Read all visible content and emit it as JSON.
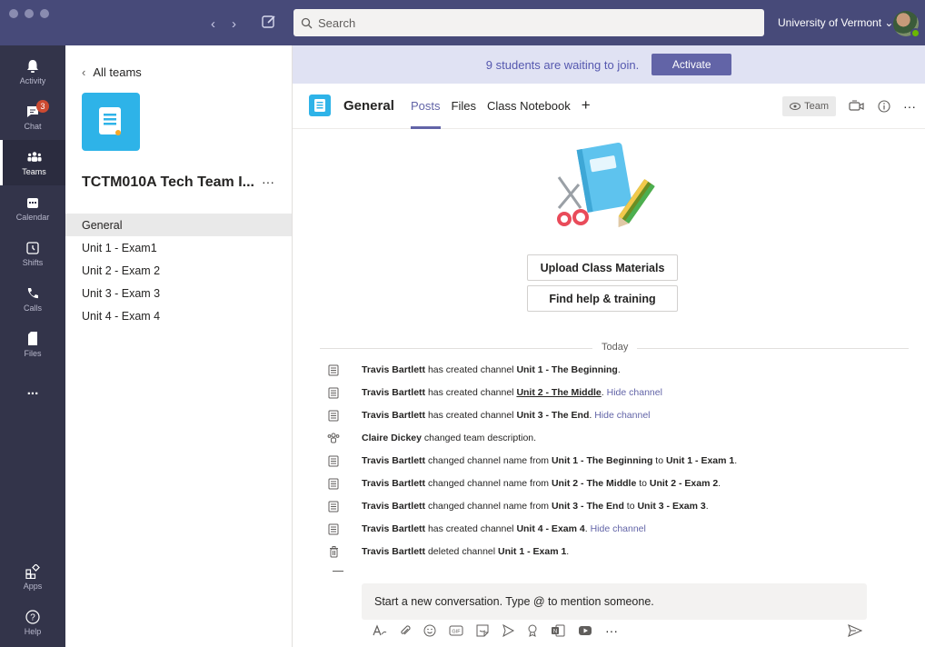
{
  "titlebar": {
    "search_placeholder": "Search",
    "org_label": "University of Vermont ⌄"
  },
  "rail": {
    "items": [
      {
        "label": "Activity"
      },
      {
        "label": "Chat",
        "badge": "3"
      },
      {
        "label": "Teams"
      },
      {
        "label": "Calendar"
      },
      {
        "label": "Shifts"
      },
      {
        "label": "Calls"
      },
      {
        "label": "Files"
      },
      {
        "label": "..."
      },
      {
        "label": "Apps"
      },
      {
        "label": "Help"
      }
    ]
  },
  "teampanel": {
    "back_label": "All teams",
    "team_name": "TCTM010A Tech Team I...",
    "more": "···",
    "channels": [
      "General",
      "Unit 1 - Exam1",
      "Unit 2 - Exam 2",
      "Unit 3 - Exam 3",
      "Unit 4 - Exam 4"
    ]
  },
  "banner": {
    "text": "9 students are waiting to join.",
    "button": "Activate"
  },
  "channel": {
    "title": "General",
    "tabs": [
      "Posts",
      "Files",
      "Class Notebook",
      "+"
    ],
    "team_button": "Team",
    "more": "···"
  },
  "content": {
    "upload_button": "Upload Class Materials",
    "help_button": "Find help & training",
    "today_label": "Today",
    "events": [
      {
        "icon": "channel-icon",
        "actor": "Travis Bartlett",
        "text": " has created channel ",
        "target": "Unit 1 - The Beginning",
        "tail": ".",
        "link": ""
      },
      {
        "icon": "channel-icon",
        "actor": "Travis Bartlett",
        "text": " has created channel ",
        "target": "Unit 2 - The Middle",
        "tail": ". ",
        "link": "Hide channel"
      },
      {
        "icon": "channel-icon",
        "actor": "Travis Bartlett",
        "text": " has created channel ",
        "target": "Unit 3 - The End",
        "tail": ". ",
        "link": "Hide channel"
      },
      {
        "icon": "people-icon",
        "actor": "Claire Dickey",
        "text": " changed team description.",
        "target": "",
        "tail": "",
        "link": ""
      },
      {
        "icon": "channel-icon",
        "actor": "Travis Bartlett",
        "text": " changed channel name from ",
        "target": "Unit 1 - The Beginning",
        "mid": " to ",
        "target2": "Unit 1 - Exam 1",
        "tail": ".",
        "link": ""
      },
      {
        "icon": "channel-icon",
        "actor": "Travis Bartlett",
        "text": " changed channel name from ",
        "target": "Unit 2 - The Middle",
        "mid": " to ",
        "target2": "Unit 2 - Exam 2",
        "tail": ".",
        "link": ""
      },
      {
        "icon": "channel-icon",
        "actor": "Travis Bartlett",
        "text": " changed channel name from ",
        "target": "Unit 3 - The End",
        "mid": " to ",
        "target2": "Unit 3 - Exam 3",
        "tail": ".",
        "link": ""
      },
      {
        "icon": "channel-icon",
        "actor": "Travis Bartlett",
        "text": " has created channel ",
        "target": "Unit 4 - Exam 4",
        "tail": ". ",
        "link": "Hide channel"
      },
      {
        "icon": "trash-icon",
        "actor": "Travis Bartlett",
        "text": " deleted channel ",
        "target": "Unit 1 - Exam 1",
        "tail": ".",
        "link": ""
      }
    ]
  },
  "composer": {
    "placeholder": "Start a new conversation. Type @ to mention someone.",
    "tools": [
      "format-icon",
      "attach-icon",
      "emoji-icon",
      "gif-icon",
      "sticker-icon",
      "meet-icon",
      "praise-icon",
      "onenote-icon",
      "youtube-icon",
      "more-icon"
    ],
    "more": "···"
  },
  "colors": {
    "titlebar": "#474a79",
    "rail": "#33344a",
    "accent": "#6264a7",
    "banner": "#e0e2f3",
    "team_tile": "#2eb3e8"
  }
}
